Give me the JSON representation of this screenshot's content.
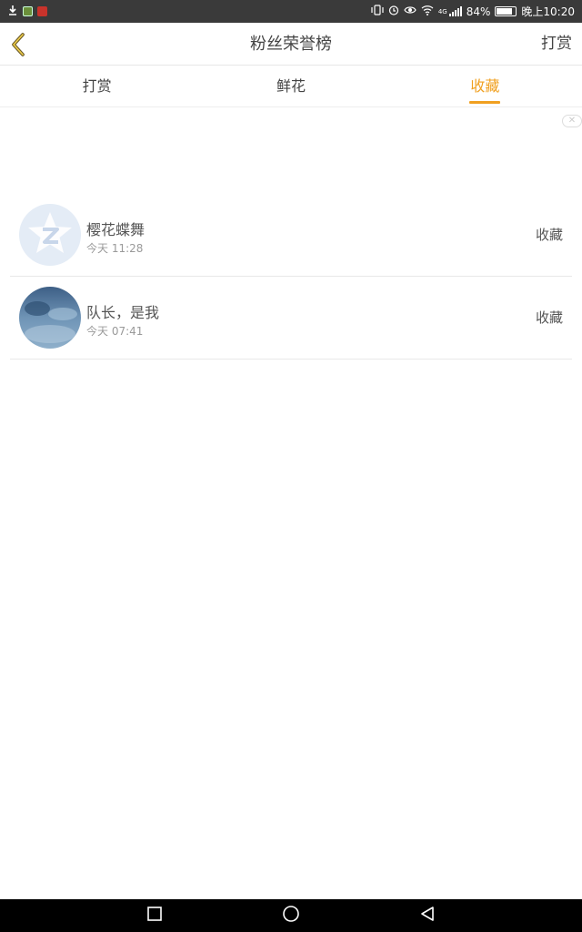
{
  "status_bar": {
    "battery": "84%",
    "clock": "晚上10:20",
    "network": "4G"
  },
  "header": {
    "title": "粉丝荣誉榜",
    "right_action": "打赏"
  },
  "tabs": [
    {
      "label": "打赏",
      "active": false
    },
    {
      "label": "鲜花",
      "active": false
    },
    {
      "label": "收藏",
      "active": true
    }
  ],
  "accent_color": "#f0a020",
  "fans": [
    {
      "name": "樱花蝶舞",
      "time": "今天 11:28",
      "action": "收藏",
      "avatar": "default-qq-avatar-icon"
    },
    {
      "name": "队长，是我",
      "time": "今天 07:41",
      "action": "收藏",
      "avatar": "photo-avatar"
    }
  ]
}
